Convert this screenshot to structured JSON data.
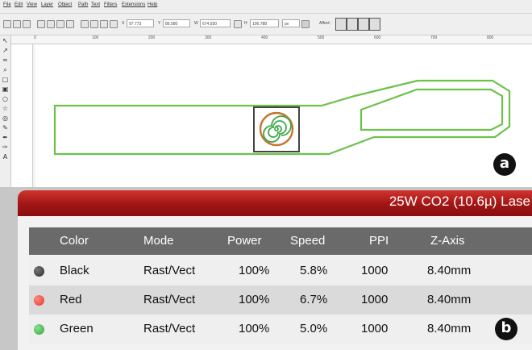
{
  "menu": [
    "File",
    "Edit",
    "View",
    "Layer",
    "Object",
    "Path",
    "Text",
    "Filters",
    "Extensions",
    "Help"
  ],
  "toolbar": {
    "x_label": "X",
    "x_value": "97.773",
    "y_label": "Y",
    "y_value": "86.580",
    "w_label": "W",
    "w_value": "674.930",
    "h_label": "H",
    "h_value": "106.788",
    "unit": "px",
    "affect_label": "Affect:"
  },
  "ruler_labels": [
    "0",
    "100",
    "200",
    "300",
    "400",
    "500",
    "600",
    "700",
    "800"
  ],
  "markers": {
    "a": "a",
    "b": "b"
  },
  "laser": {
    "title": "25W CO2 (10.6µ) Lase",
    "columns": [
      "Color",
      "Mode",
      "Power",
      "Speed",
      "PPI",
      "Z-Axis"
    ],
    "rows": [
      {
        "color": "Black",
        "mode": "Rast/Vect",
        "power": "100%",
        "speed": "5.8%",
        "ppi": "1000",
        "z": "8.40mm",
        "swatch": "#2a2a2a"
      },
      {
        "color": "Red",
        "mode": "Rast/Vect",
        "power": "100%",
        "speed": "6.7%",
        "ppi": "1000",
        "z": "8.40mm",
        "swatch": "#e8302a"
      },
      {
        "color": "Green",
        "mode": "Rast/Vect",
        "power": "100%",
        "speed": "5.0%",
        "ppi": "1000",
        "z": "8.40mm",
        "swatch": "#2ea43a"
      }
    ]
  },
  "colors": {
    "outline_green": "#6cc24a",
    "spiral_orange": "#c8732c",
    "header_red": "#b51b1b"
  }
}
